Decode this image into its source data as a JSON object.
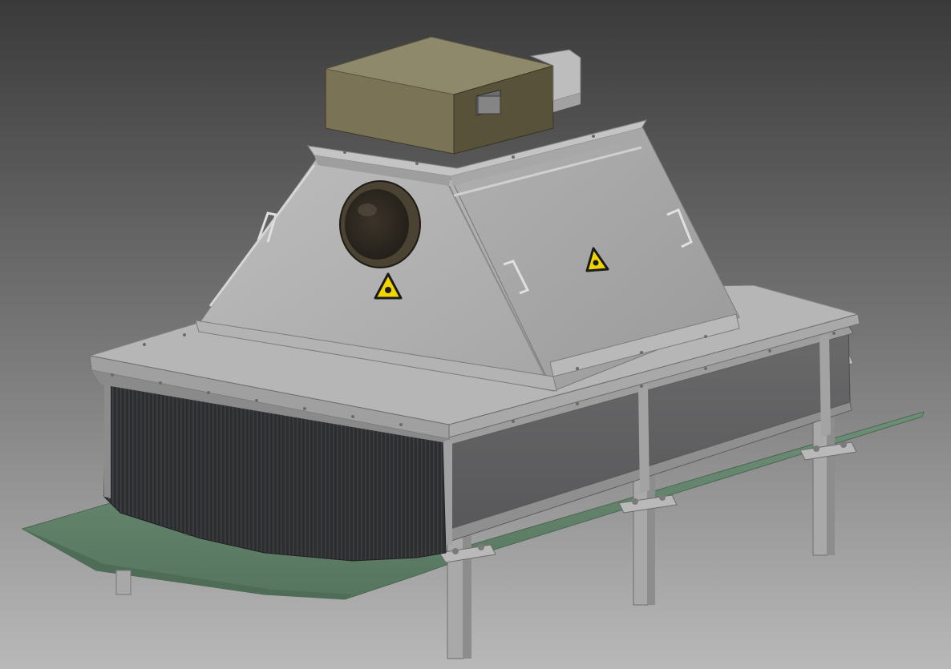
{
  "scene": {
    "subject": "3d-cad-render",
    "background": {
      "top": "#3a3a3a",
      "bottom": "#b9b9b9"
    },
    "colors": {
      "steel_light": "#b3b3b3",
      "steel_mid": "#9c9c9c",
      "steel_dark": "#6e6e6e",
      "steel_shadow": "#5d5d5e",
      "coil": "#2e2f31",
      "coil_fin": "#3a3b3e",
      "control_box": "#7a7356",
      "control_box_top": "#8f896b",
      "drip_tray": "#5f7f67",
      "viewport_ring": "#4a4232",
      "viewport_glass": "#2f2a22",
      "warning_yellow": "#f1d500",
      "warning_border": "#1b1b1b"
    },
    "icons": [
      "hazard-warning-icon",
      "hazard-warning-icon"
    ]
  }
}
